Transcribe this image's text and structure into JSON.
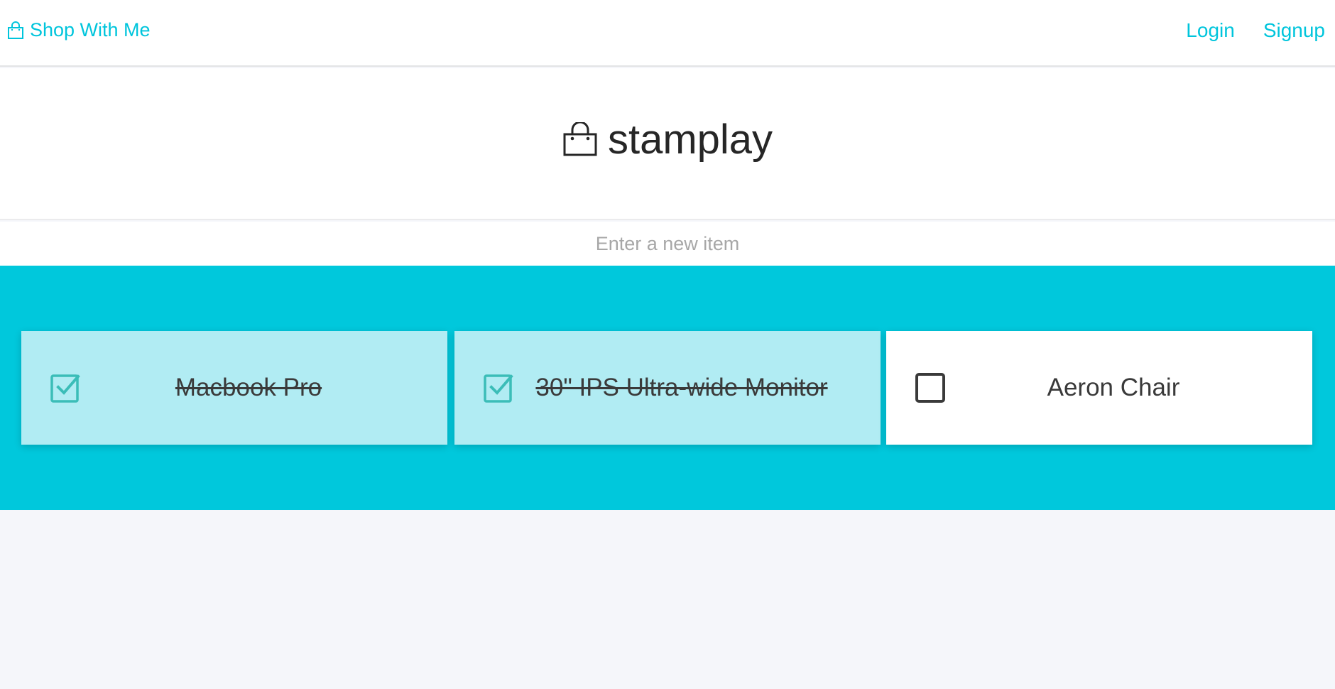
{
  "navbar": {
    "brand_icon": "shopping-bag-icon",
    "brand_label": "Shop With Me",
    "login_label": "Login",
    "signup_label": "Signup",
    "accent_color": "#00c5dc"
  },
  "hero": {
    "logo_icon": "shopping-bag-icon",
    "logo_text": "stamplay"
  },
  "new_item": {
    "placeholder": "Enter a new item",
    "value": ""
  },
  "items": [
    {
      "label": "Macbook Pro",
      "checked": true
    },
    {
      "label": "30\" IPS Ultra-wide Monitor",
      "checked": true
    },
    {
      "label": "Aeron Chair",
      "checked": false
    }
  ],
  "colors": {
    "band": "#00c8dc",
    "done_card": "#b1ecf3",
    "todo_card": "#ffffff",
    "check_done": "#3bbdb8",
    "check_todo": "#3a3a3a"
  }
}
